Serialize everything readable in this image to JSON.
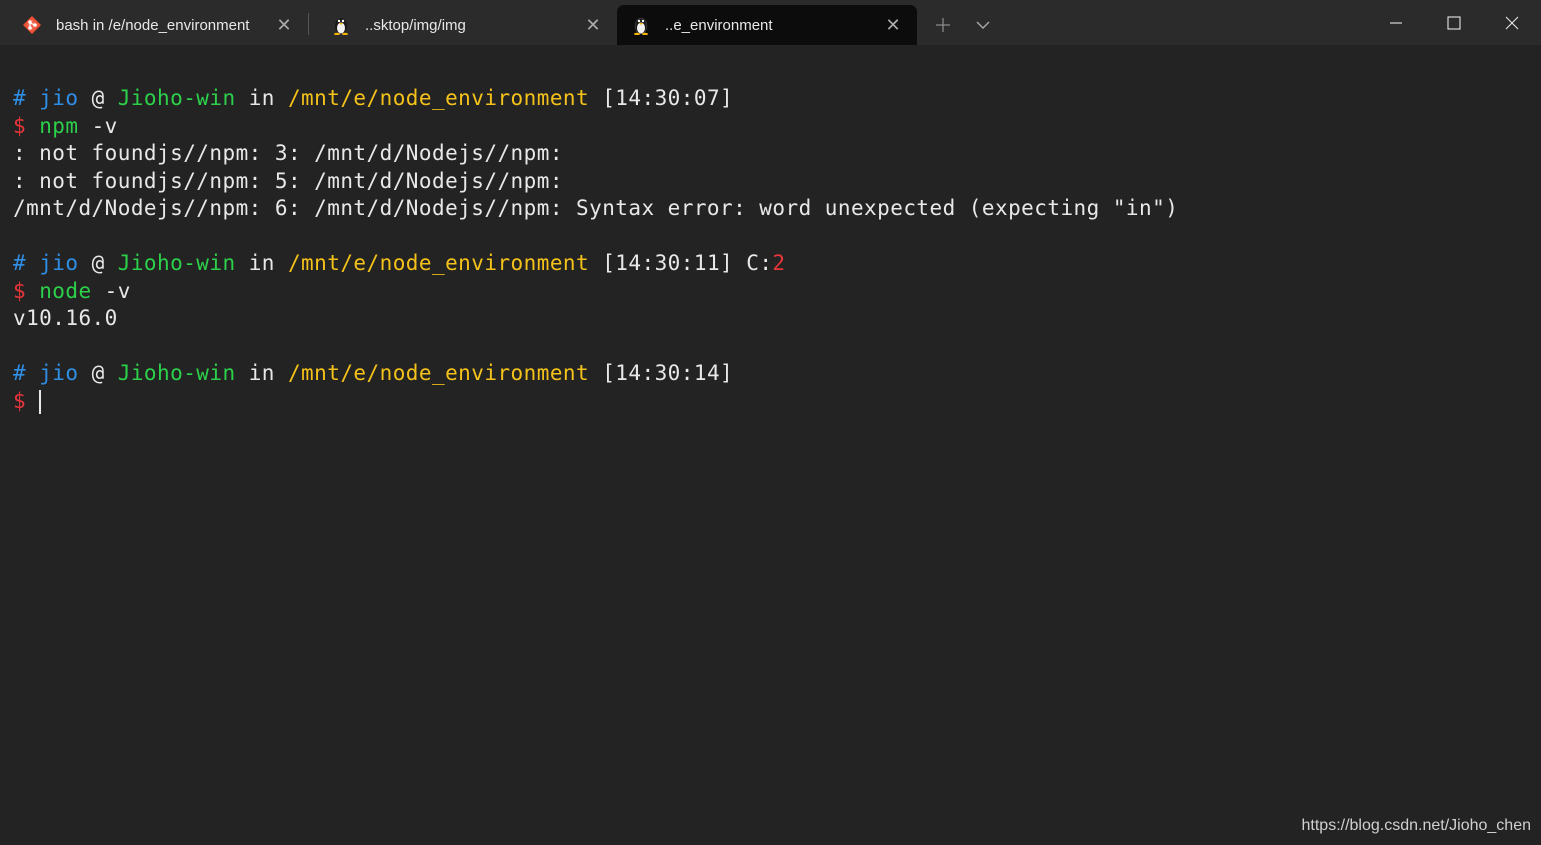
{
  "tabs": [
    {
      "label": "bash in /e/node_environment",
      "icon": "git-bash-icon",
      "active": false
    },
    {
      "label": "..sktop/img/img",
      "icon": "linux-penguin-icon",
      "active": false
    },
    {
      "label": "..e_environment",
      "icon": "linux-penguin-icon",
      "active": true
    }
  ],
  "terminal": {
    "prompts": [
      {
        "hash": "#",
        "user": "jio",
        "at": "@",
        "host": "Jioho-win",
        "in": "in",
        "path": "/mnt/e/node_environment",
        "time": "[14:30:07]",
        "exit_prefix": "",
        "exit_code": ""
      },
      {
        "hash": "#",
        "user": "jio",
        "at": "@",
        "host": "Jioho-win",
        "in": "in",
        "path": "/mnt/e/node_environment",
        "time": "[14:30:11]",
        "exit_prefix": "C:",
        "exit_code": "2"
      },
      {
        "hash": "#",
        "user": "jio",
        "at": "@",
        "host": "Jioho-win",
        "in": "in",
        "path": "/mnt/e/node_environment",
        "time": "[14:30:14]",
        "exit_prefix": "",
        "exit_code": ""
      }
    ],
    "dollar": "$",
    "commands": [
      {
        "cmd": "npm",
        "args": "-v"
      },
      {
        "cmd": "node",
        "args": "-v"
      }
    ],
    "outputs": {
      "npm": [
        ": not foundjs//npm: 3: /mnt/d/Nodejs//npm:",
        ": not foundjs//npm: 5: /mnt/d/Nodejs//npm:",
        "/mnt/d/Nodejs//npm: 6: /mnt/d/Nodejs//npm: Syntax error: word unexpected (expecting \"in\")"
      ],
      "node": [
        "v10.16.0"
      ]
    }
  },
  "watermark": "https://blog.csdn.net/Jioho_chen",
  "colors": {
    "blue": "#2f8fe6",
    "green": "#2cd04a",
    "yellow": "#f4c21a",
    "red": "#e8353a",
    "background": "#232323"
  }
}
